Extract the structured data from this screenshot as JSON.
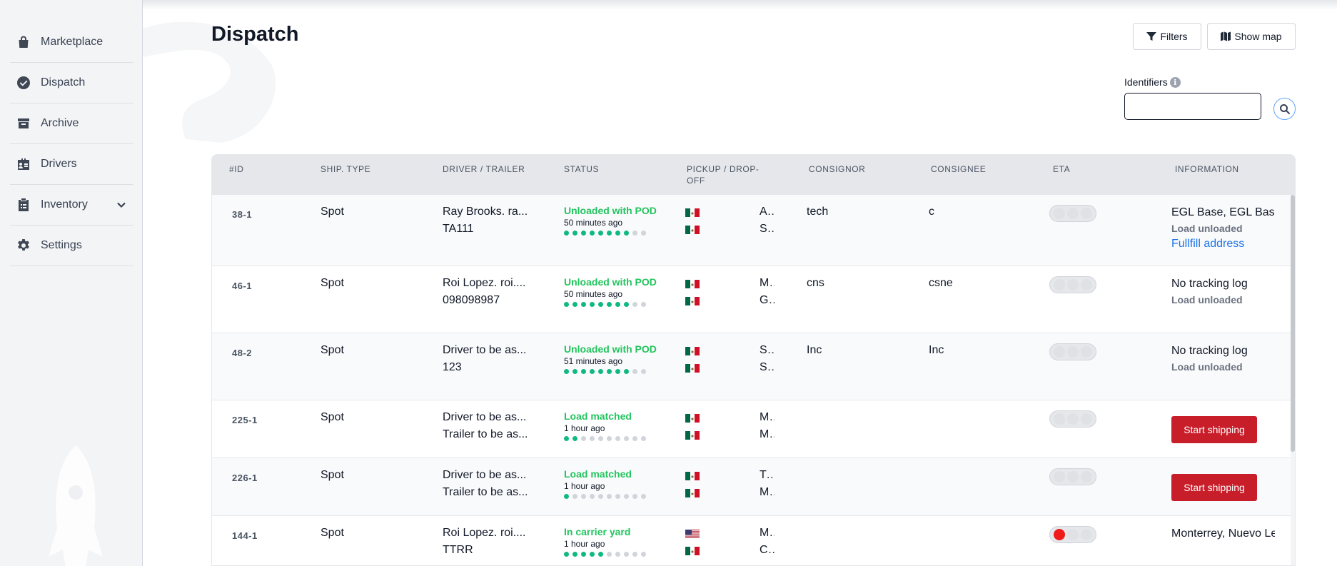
{
  "sidebar": {
    "items": [
      {
        "label": "Marketplace",
        "icon": "shopping-bag-icon"
      },
      {
        "label": "Dispatch",
        "icon": "check-circle-icon"
      },
      {
        "label": "Archive",
        "icon": "archive-box-icon"
      },
      {
        "label": "Drivers",
        "icon": "id-card-icon"
      },
      {
        "label": "Inventory",
        "icon": "clipboard-icon"
      },
      {
        "label": "Settings",
        "icon": "gear-icon"
      }
    ]
  },
  "page": {
    "title": "Dispatch",
    "filters_label": "Filters",
    "show_map_label": "Show map",
    "identifiers_label": "Identifiers",
    "identifiers_value": ""
  },
  "table": {
    "headers": [
      "#ID",
      "SHIP. TYPE",
      "DRIVER / TRAILER",
      "STATUS",
      "PICKUP / DROP-OFF",
      "CONSIGNOR",
      "CONSIGNEE",
      "ETA",
      "INFORMATION"
    ],
    "rows": [
      {
        "id": "38-1",
        "type": "Spot",
        "driver": "Ray Brooks. ra...",
        "trailer": "TA111",
        "status": "Unloaded with POD",
        "time": "50 minutes ago",
        "progress": 8,
        "pickup": "Acapulco d...",
        "pickup_flag": "mx",
        "dropoff": "Santiago J...",
        "dropoff_flag": "mx",
        "consignor": "tech",
        "consignee": "c",
        "eta_state": "none",
        "info_main": "EGL Base, EGL Base",
        "info_sub": "Load unloaded",
        "info_link": "Fullfill address",
        "action": ""
      },
      {
        "id": "46-1",
        "type": "Spot",
        "driver": "Roi Lopez. roi....",
        "trailer": "098098987",
        "status": "Unloaded with POD",
        "time": "50 minutes ago",
        "progress": 8,
        "pickup": "Monterrey, ...",
        "pickup_flag": "mx",
        "dropoff": "Guadalajar...",
        "dropoff_flag": "mx",
        "consignor": "cns",
        "consignee": "csne",
        "eta_state": "none",
        "info_main": "No tracking log",
        "info_sub": "Load unloaded",
        "info_link": "",
        "action": ""
      },
      {
        "id": "48-2",
        "type": "Spot",
        "driver": "Driver to be as...",
        "trailer": "123",
        "status": "Unloaded with POD",
        "time": "51 minutes ago",
        "progress": 8,
        "pickup": "San Luis P...",
        "pickup_flag": "mx",
        "dropoff": "Santiago d...",
        "dropoff_flag": "mx",
        "consignor": "Inc",
        "consignee": "Inc",
        "eta_state": "none",
        "info_main": "No tracking log",
        "info_sub": "Load unloaded",
        "info_link": "",
        "action": ""
      },
      {
        "id": "225-1",
        "type": "Spot",
        "driver": "Driver to be as...",
        "trailer": "Trailer to be as...",
        "status": "Load matched",
        "time": "1 hour ago",
        "progress": 2,
        "pickup": "Monterrey, ...",
        "pickup_flag": "mx",
        "dropoff": "Mexico City...",
        "dropoff_flag": "mx",
        "consignor": "",
        "consignee": "",
        "eta_state": "none",
        "info_main": "",
        "info_sub": "",
        "info_link": "",
        "action": "Start shipping"
      },
      {
        "id": "226-1",
        "type": "Spot",
        "driver": "Driver to be as...",
        "trailer": "Trailer to be as...",
        "status": "Load matched",
        "time": "1 hour ago",
        "progress": 1,
        "pickup": "Tijuana, Ba...",
        "pickup_flag": "mx",
        "dropoff": "Mexicali, B...",
        "dropoff_flag": "mx",
        "consignor": "",
        "consignee": "",
        "eta_state": "none",
        "info_main": "",
        "info_sub": "",
        "info_link": "",
        "action": "Start shipping"
      },
      {
        "id": "144-1",
        "type": "Spot",
        "driver": "Roi Lopez. roi....",
        "trailer": "TTRR",
        "status": "In carrier yard",
        "time": "1 hour ago",
        "progress": 5,
        "pickup": "Montgomer...",
        "pickup_flag": "us",
        "dropoff": "Crucecita, ...",
        "dropoff_flag": "mx",
        "consignor": "",
        "consignee": "",
        "eta_state": "red",
        "info_main": "Monterrey, Nuevo León",
        "info_sub": "",
        "info_link": "",
        "action": ""
      }
    ]
  },
  "colors": {
    "accent_red": "#c81e2a",
    "status_green": "#22c55e",
    "link_blue": "#1a73e8"
  }
}
